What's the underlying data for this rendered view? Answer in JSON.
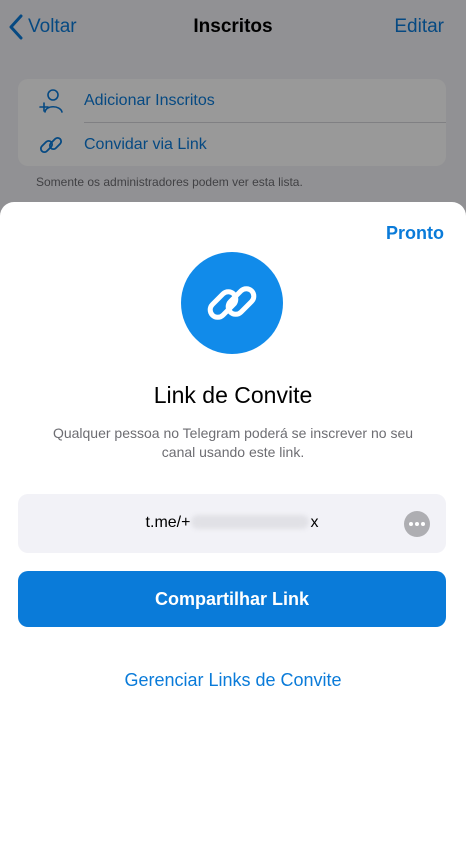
{
  "nav": {
    "back_label": "Voltar",
    "title": "Inscritos",
    "edit_label": "Editar"
  },
  "list": {
    "items": [
      {
        "label": "Adicionar Inscritos",
        "icon": "add-user-icon"
      },
      {
        "label": "Convidar via Link",
        "icon": "link-icon"
      }
    ],
    "footnote": "Somente os administradores podem ver esta lista."
  },
  "sheet": {
    "done_label": "Pronto",
    "icon": "link-icon",
    "title": "Link de Convite",
    "description": "Qualquer pessoa no Telegram poderá se inscrever no seu canal usando este link.",
    "link_prefix": "t.me/+",
    "link_suffix": "x",
    "share_label": "Compartilhar Link",
    "manage_label": "Gerenciar Links de Convite"
  },
  "colors": {
    "accent": "#0a7bd9",
    "icon_circle": "#118bea"
  }
}
